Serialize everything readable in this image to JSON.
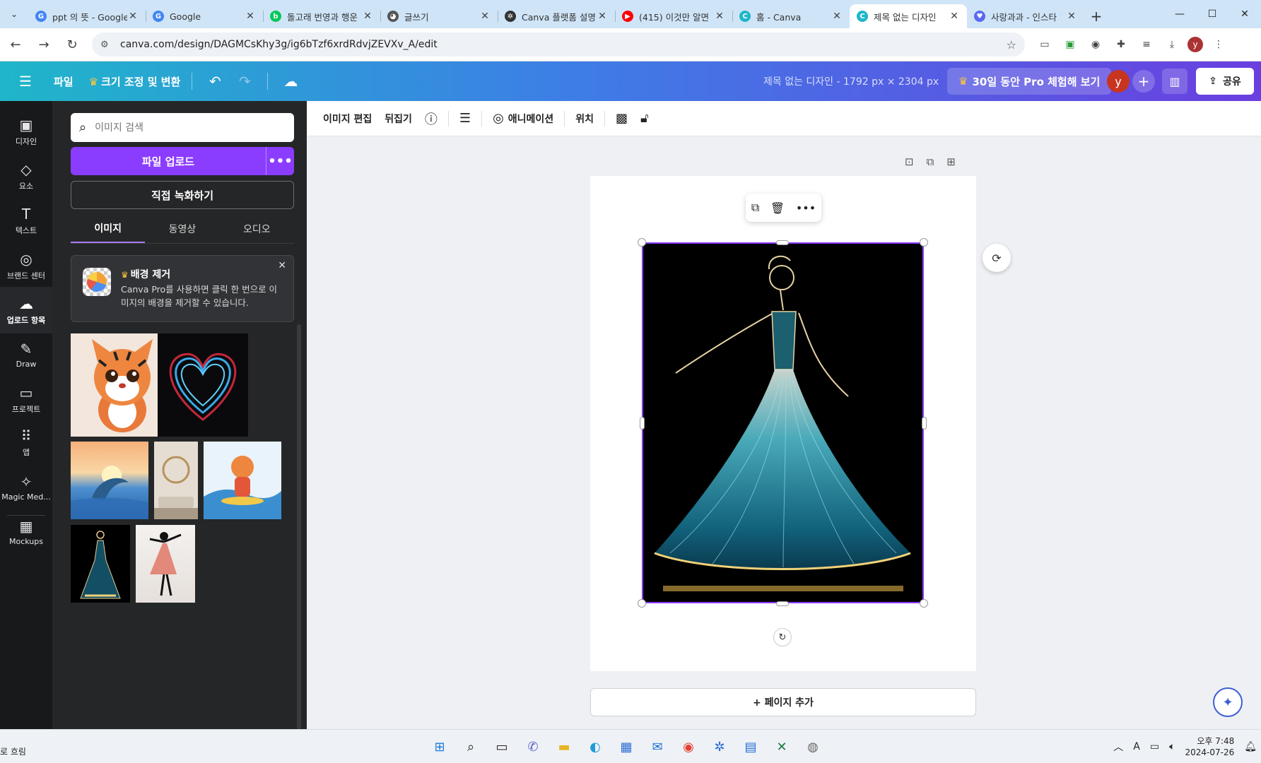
{
  "browser": {
    "tabs": [
      {
        "title": "ppt 의 뜻 - Google",
        "fav": "G",
        "color": "#4285f4"
      },
      {
        "title": "Google",
        "fav": "G",
        "color": "#4285f4"
      },
      {
        "title": "돌고래 번영과 행운",
        "fav": "b",
        "color": "#03c75a"
      },
      {
        "title": "글쓰기",
        "fav": "◕",
        "color": "#555"
      },
      {
        "title": "Canva 플랫폼 설명",
        "fav": "✲",
        "color": "#333"
      },
      {
        "title": "(415) 이것만 알면",
        "fav": "▶",
        "color": "#ff0000"
      },
      {
        "title": "홈 - Canva",
        "fav": "C",
        "color": "#1fb6c9"
      },
      {
        "title": "제목 없는 디자인",
        "fav": "C",
        "color": "#1fb6c9"
      },
      {
        "title": "사랑과과 - 인스타",
        "fav": "♥",
        "color": "#5b6af0"
      }
    ],
    "url": "canva.com/design/DAGMCsKhy3g/ig6bTzf6xrdRdvjZEVXv_A/edit",
    "profile_initial": "y"
  },
  "header": {
    "file": "파일",
    "resize": "크기 조정 및 변환",
    "doc_title": "제목 없는 디자인 - 1792 px × 2304 px",
    "pro_trial": "30일 동안 Pro 체험해 보기",
    "avatar": "y",
    "share": "공유"
  },
  "rail": [
    {
      "label": "디자인",
      "icon": "▣",
      "name": "rail-design"
    },
    {
      "label": "요소",
      "icon": "◇",
      "name": "rail-elements"
    },
    {
      "label": "텍스트",
      "icon": "T",
      "name": "rail-text"
    },
    {
      "label": "브랜드 센터",
      "icon": "◎",
      "name": "rail-brand"
    },
    {
      "label": "업로드 항목",
      "icon": "☁",
      "name": "rail-uploads"
    },
    {
      "label": "Draw",
      "icon": "✎",
      "name": "rail-draw"
    },
    {
      "label": "프로젝트",
      "icon": "▭",
      "name": "rail-projects"
    },
    {
      "label": "앱",
      "icon": "⠿",
      "name": "rail-apps"
    },
    {
      "label": "Magic Med...",
      "icon": "✧",
      "name": "rail-magic-media"
    },
    {
      "label": "Mockups",
      "icon": "▦",
      "name": "rail-mockups"
    }
  ],
  "panel": {
    "search_placeholder": "이미지 검색",
    "upload": "파일 업로드",
    "record": "직접 녹화하기",
    "tabs": [
      "이미지",
      "동영상",
      "오디오"
    ],
    "promo_title": "배경 제거",
    "promo_desc": "Canva Pro를 사용하면 클릭 한 번으로 이미지의 배경을 제거할 수 있습니다."
  },
  "context_toolbar": {
    "edit_image": "이미지 편집",
    "flip": "뒤집기",
    "animate": "애니메이션",
    "position": "위치"
  },
  "canvas": {
    "add_page": "+ 페이지 추가"
  },
  "taskbar": {
    "left_text": "로 흐림",
    "time": "오후 7:48",
    "date": "2024-07-26"
  }
}
